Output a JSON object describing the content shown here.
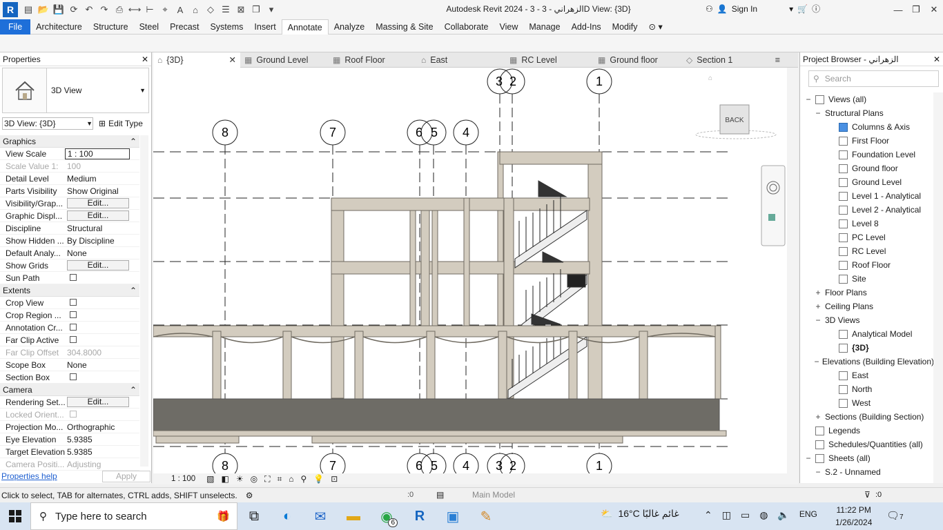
{
  "window": {
    "title": "Autodesk Revit 2024 - الزهراني - 3 - 3D View: {3D}",
    "signin": "Sign In"
  },
  "ribbon": {
    "tabs": [
      "File",
      "Architecture",
      "Structure",
      "Steel",
      "Precast",
      "Systems",
      "Insert",
      "Annotate",
      "Analyze",
      "Massing & Site",
      "Collaborate",
      "View",
      "Manage",
      "Add-Ins",
      "Modify"
    ],
    "active": "Annotate"
  },
  "properties": {
    "title": "Properties",
    "type_name": "3D View",
    "type_selector": "3D View: {3D}",
    "edit_type": "Edit Type",
    "sections": {
      "graphics": "Graphics",
      "extents": "Extents",
      "camera": "Camera"
    },
    "rows": {
      "view_scale": [
        "View Scale",
        "1 : 100"
      ],
      "scale_value": [
        "Scale Value  1:",
        "100"
      ],
      "detail_level": [
        "Detail Level",
        "Medium"
      ],
      "parts_visibility": [
        "Parts Visibility",
        "Show Original"
      ],
      "visibility_graphics": [
        "Visibility/Grap...",
        "Edit..."
      ],
      "graphic_display": [
        "Graphic Displ...",
        "Edit..."
      ],
      "discipline": [
        "Discipline",
        "Structural"
      ],
      "show_hidden": [
        "Show Hidden ...",
        "By Discipline"
      ],
      "default_analysis": [
        "Default Analy...",
        "None"
      ],
      "show_grids": [
        "Show Grids",
        "Edit..."
      ],
      "sun_path": [
        "Sun Path",
        ""
      ],
      "crop_view": [
        "Crop View",
        ""
      ],
      "crop_region": [
        "Crop Region ...",
        ""
      ],
      "annotation_crop": [
        "Annotation Cr...",
        ""
      ],
      "far_clip_active": [
        "Far Clip Active",
        ""
      ],
      "far_clip_offset": [
        "Far Clip Offset",
        "304.8000"
      ],
      "scope_box": [
        "Scope Box",
        "None"
      ],
      "section_box": [
        "Section Box",
        ""
      ],
      "rendering_settings": [
        "Rendering Set...",
        "Edit..."
      ],
      "locked_orientation": [
        "Locked Orient...",
        ""
      ],
      "projection_mode": [
        "Projection Mo...",
        "Orthographic"
      ],
      "eye_elevation": [
        "Eye Elevation",
        "5.9385"
      ],
      "target_elevation": [
        "Target Elevation",
        "5.9385"
      ],
      "camera_position": [
        "Camera Positi...",
        "Adjusting"
      ]
    },
    "help": "Properties help",
    "apply": "Apply"
  },
  "view_tabs": [
    {
      "label": "{3D}",
      "icon": "home-icon"
    },
    {
      "label": "Ground Level",
      "icon": "plan-icon"
    },
    {
      "label": "Roof Floor",
      "icon": "plan-icon"
    },
    {
      "label": "East",
      "icon": "elevation-icon"
    },
    {
      "label": "RC Level",
      "icon": "plan-icon"
    },
    {
      "label": "Ground floor",
      "icon": "plan-icon"
    },
    {
      "label": "Section 1",
      "icon": "section-icon"
    }
  ],
  "canvas": {
    "grid_top": [
      "3",
      "2",
      "1"
    ],
    "grid_mid": [
      "8",
      "7",
      "6",
      "5",
      "4"
    ],
    "grid_bottom": [
      "8",
      "7",
      "6",
      "5",
      "4",
      "3",
      "2",
      "1"
    ],
    "viewcube_label": "BACK",
    "scale": "1 : 100"
  },
  "browser": {
    "title": "Project Browser - الزهراني",
    "search_placeholder": "Search",
    "views_all": "Views (all)",
    "structural_plans": "Structural Plans",
    "plans": [
      "Columns & Axis",
      "First Floor",
      "Foundation Level",
      "Ground floor",
      "Ground Level",
      "Level 1 - Analytical",
      "Level 2 - Analytical",
      "Level 8",
      "PC Level",
      "RC Level",
      "Roof Floor",
      "Site"
    ],
    "floor_plans": "Floor Plans",
    "ceiling_plans": "Ceiling Plans",
    "views_3d": "3D Views",
    "views_3d_items": [
      "Analytical Model",
      "{3D}"
    ],
    "elevations": "Elevations (Building Elevation)",
    "elevation_items": [
      "East",
      "North",
      "West"
    ],
    "sections": "Sections (Building Section)",
    "legends": "Legends",
    "schedules": "Schedules/Quantities (all)",
    "sheets": "Sheets (all)",
    "sheet_item": "S.2 - Unnamed"
  },
  "status": {
    "text": "Click to select, TAB for alternates, CTRL adds, SHIFT unselects.",
    "zero": ":0",
    "main_model": "Main Model",
    "filter": ":0"
  },
  "taskbar": {
    "search": "Type here to search",
    "weather": "16°C  غائم غالبًا",
    "lang": "ENG",
    "time": "11:22 PM",
    "date": "1/26/2024",
    "badge": "6",
    "notif_count": "7"
  }
}
